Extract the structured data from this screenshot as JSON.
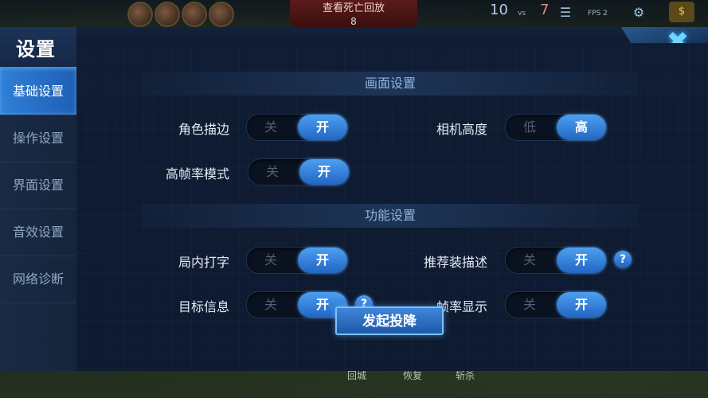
{
  "hud": {
    "replay_label": "查看死亡回放",
    "replay_count": "8",
    "score_left": "10",
    "vs": "vs",
    "score_right": "7",
    "fps_label": "FPS 2",
    "skills": [
      "回城",
      "恢复",
      "斩杀"
    ]
  },
  "panel": {
    "title": "设置",
    "close": "✖"
  },
  "sidebar": {
    "items": [
      {
        "label": "基础设置",
        "active": true
      },
      {
        "label": "操作设置",
        "active": false
      },
      {
        "label": "界面设置",
        "active": false
      },
      {
        "label": "音效设置",
        "active": false
      },
      {
        "label": "网络诊断",
        "active": false
      }
    ]
  },
  "sections": {
    "display": {
      "title": "画面设置",
      "outline": {
        "label": "角色描边",
        "off": "关",
        "on": "开",
        "value": "开"
      },
      "camera_height": {
        "label": "相机高度",
        "off": "低",
        "on": "高",
        "value": "高"
      },
      "high_fps": {
        "label": "高帧率模式",
        "off": "关",
        "on": "开",
        "value": "开"
      }
    },
    "function": {
      "title": "功能设置",
      "in_game_typing": {
        "label": "局内打字",
        "off": "关",
        "on": "开",
        "value": "开"
      },
      "recommended_gear_desc": {
        "label": "推荐装描述",
        "off": "关",
        "on": "开",
        "value": "开"
      },
      "target_info": {
        "label": "目标信息",
        "off": "关",
        "on": "开",
        "value": "开"
      },
      "fps_display": {
        "label": "帧率显示",
        "off": "关",
        "on": "开",
        "value": "开"
      }
    }
  },
  "surrender_button": "发起投降",
  "help_icon": "?",
  "colors": {
    "accent": "#2f7fd8",
    "toggle_on": "#2166c4",
    "panel_bg": "#0f1c33"
  }
}
